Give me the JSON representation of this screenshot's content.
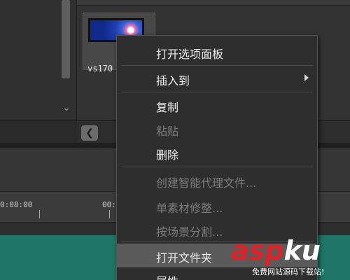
{
  "bin": {
    "column_headers": [
      "",
      "",
      "",
      ""
    ],
    "clip": {
      "label": "vs170"
    }
  },
  "timeline": {
    "ruler_labels": [
      "0:08:00",
      "00:"
    ]
  },
  "context_menu": {
    "items": [
      {
        "label": "打开选项面板",
        "enabled": true
      },
      {
        "label": "插入到",
        "enabled": true,
        "submenu": true
      },
      {
        "label": "复制",
        "enabled": true
      },
      {
        "label": "粘贴",
        "enabled": false
      },
      {
        "label": "删除",
        "enabled": true
      },
      {
        "label": "创建智能代理文件...",
        "enabled": false
      },
      {
        "label": "单素材修整...",
        "enabled": false
      },
      {
        "label": "按场景分割...",
        "enabled": false
      },
      {
        "label": "打开文件夹",
        "enabled": true,
        "hover": true
      },
      {
        "label": "属性",
        "enabled": true
      }
    ]
  },
  "watermark": {
    "logo_part1": "asp",
    "logo_part2": "ku",
    "logo_suffix": ".com",
    "tagline": "免费网站源码下载站!"
  },
  "colors": {
    "menu_bg": "#2e2e2e",
    "menu_hover": "#5a5a5a",
    "track": "#1e7566",
    "watermark_red": "#e22026"
  },
  "icons": {
    "chevron": "chevron-down-icon",
    "scroll_left": "chevron-left-icon",
    "submenu": "submenu-arrow-icon"
  }
}
